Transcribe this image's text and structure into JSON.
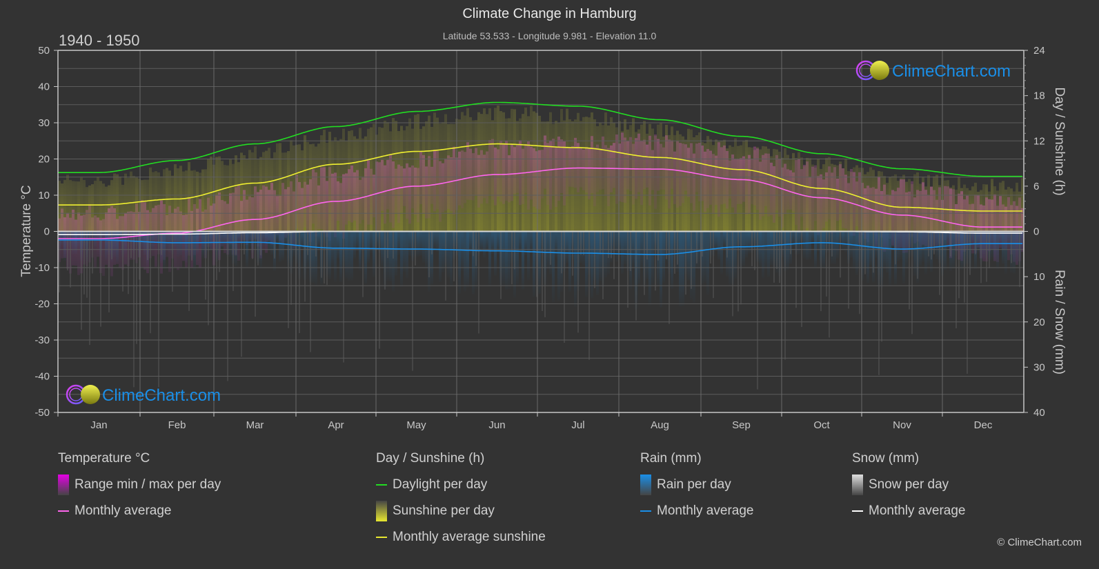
{
  "header": {
    "title": "Climate Change in Hamburg",
    "subtitle": "Latitude 53.533 - Longitude 9.981 - Elevation 11.0",
    "period": "1940 - 1950"
  },
  "watermark": "ClimeChart.com",
  "copyright": "© ClimeChart.com",
  "colors": {
    "background": "#333333",
    "temperature_avg": "#ff66ee",
    "temperature_range": "#e600e6",
    "daylight": "#22dd22",
    "sunshine_avg": "#f0f030",
    "sunshine_fill": "#a0a030",
    "rain": "#1a8fe8",
    "snow": "#ffffff",
    "watermark_text": "#1a8fe8"
  },
  "legend": {
    "groups": [
      {
        "title": "Temperature °C",
        "items": [
          {
            "label": "Range min / max per day",
            "kind": "box",
            "color": "#e600e6"
          },
          {
            "label": "Monthly average",
            "kind": "line",
            "color": "#ff66ee"
          }
        ]
      },
      {
        "title": "Day / Sunshine (h)",
        "items": [
          {
            "label": "Daylight per day",
            "kind": "line",
            "color": "#22dd22"
          },
          {
            "label": "Sunshine per day",
            "kind": "box",
            "color": "#e8e830"
          },
          {
            "label": "Monthly average sunshine",
            "kind": "line",
            "color": "#e8e830"
          }
        ]
      },
      {
        "title": "Rain (mm)",
        "items": [
          {
            "label": "Rain per day",
            "kind": "box",
            "color": "#1a8fe8"
          },
          {
            "label": "Monthly average",
            "kind": "line",
            "color": "#1a8fe8"
          }
        ]
      },
      {
        "title": "Snow (mm)",
        "items": [
          {
            "label": "Snow per day",
            "kind": "box",
            "color": "#e0e0e0"
          },
          {
            "label": "Monthly average",
            "kind": "line",
            "color": "#ffffff"
          }
        ]
      }
    ]
  },
  "chart_data": {
    "type": "line",
    "title": "Climate Change in Hamburg",
    "subtitle": "Latitude 53.533 - Longitude 9.981 - Elevation 11.0",
    "categories": [
      "Jan",
      "Feb",
      "Mar",
      "Apr",
      "May",
      "Jun",
      "Jul",
      "Aug",
      "Sep",
      "Oct",
      "Nov",
      "Dec"
    ],
    "axes": {
      "left": {
        "label": "Temperature °C",
        "range": [
          -50,
          50
        ],
        "ticks": [
          50,
          40,
          30,
          20,
          10,
          0,
          -10,
          -20,
          -30,
          -40,
          -50
        ]
      },
      "right_top": {
        "label": "Day / Sunshine (h)",
        "range": [
          0,
          24
        ],
        "ticks": [
          24,
          18,
          12,
          6,
          0
        ]
      },
      "right_bottom": {
        "label": "Rain / Snow (mm)",
        "range": [
          0,
          40
        ],
        "ticks": [
          0,
          10,
          20,
          30,
          40
        ],
        "inverted": true
      }
    },
    "grid": true,
    "series": [
      {
        "name": "Temperature monthly average (°C)",
        "axis": "left",
        "values": [
          -2.0,
          -0.5,
          3.3,
          8.3,
          12.5,
          15.7,
          17.5,
          17.2,
          14.3,
          9.3,
          4.5,
          1.2
        ]
      },
      {
        "name": "Daylight per day (h)",
        "axis": "right_top",
        "values": [
          7.8,
          9.4,
          11.6,
          13.9,
          15.9,
          17.1,
          16.6,
          14.8,
          12.6,
          10.3,
          8.3,
          7.3
        ]
      },
      {
        "name": "Monthly average sunshine (h)",
        "axis": "right_top",
        "values": [
          3.5,
          4.3,
          6.4,
          8.9,
          10.6,
          11.6,
          11.1,
          9.8,
          8.2,
          5.7,
          3.2,
          2.7
        ]
      },
      {
        "name": "Rain monthly average (mm)",
        "axis": "right_bottom",
        "values": [
          1.9,
          2.5,
          2.4,
          3.7,
          3.9,
          4.3,
          4.8,
          5.1,
          3.4,
          2.5,
          3.9,
          2.7
        ]
      },
      {
        "name": "Snow monthly average (mm)",
        "axis": "right_bottom",
        "values": [
          0.7,
          0.6,
          0.3,
          0.0,
          0.0,
          0.0,
          0.0,
          0.0,
          0.0,
          0.0,
          0.1,
          0.4
        ]
      }
    ],
    "legend_position": "bottom"
  }
}
